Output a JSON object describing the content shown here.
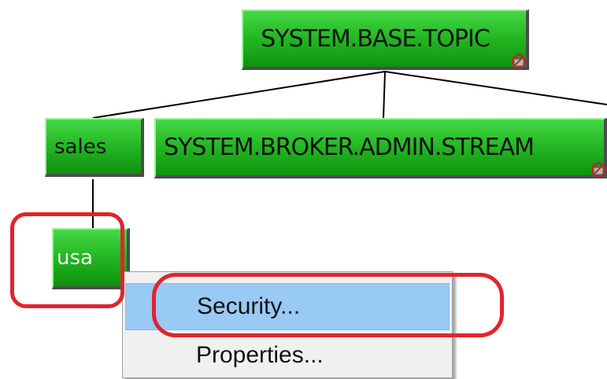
{
  "topic_tree": {
    "root": {
      "label": "SYSTEM.BASE.TOPIC",
      "icon": "lock-icon",
      "children": [
        {
          "label": "sales",
          "children": [
            {
              "label": "usa",
              "selected": true
            }
          ]
        },
        {
          "label": "SYSTEM.BROKER.ADMIN.STREAM",
          "icon": "lock-icon"
        }
      ]
    }
  },
  "context_menu": {
    "items": [
      {
        "label": "Security...",
        "highlighted": true
      },
      {
        "label": "Properties..."
      }
    ]
  },
  "colors": {
    "node_green": "#22b622",
    "menu_highlight": "#99c9f5",
    "annotation_red": "#e0242c"
  }
}
